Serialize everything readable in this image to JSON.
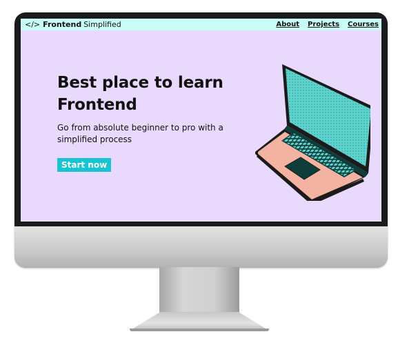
{
  "navbar": {
    "brand_mark": "</>",
    "brand_strong": "Frontend",
    "brand_rest": "Simplified",
    "links": [
      {
        "label": "About"
      },
      {
        "label": "Projects"
      },
      {
        "label": "Courses"
      }
    ]
  },
  "hero": {
    "title": "Best place to learn Frontend",
    "subtitle": "Go from absolute beginner to pro with a simplified process",
    "cta_label": "Start now"
  },
  "colors": {
    "screen_bg": "#e8d9fd",
    "navbar_bg": "#c9fbf7",
    "cta_bg": "#18c4d2",
    "laptop_screen": "#5fd3ce",
    "laptop_body": "#f4b2a0",
    "laptop_keys": "#0f3d3b"
  },
  "illustration": {
    "icon": "laptop-icon"
  }
}
